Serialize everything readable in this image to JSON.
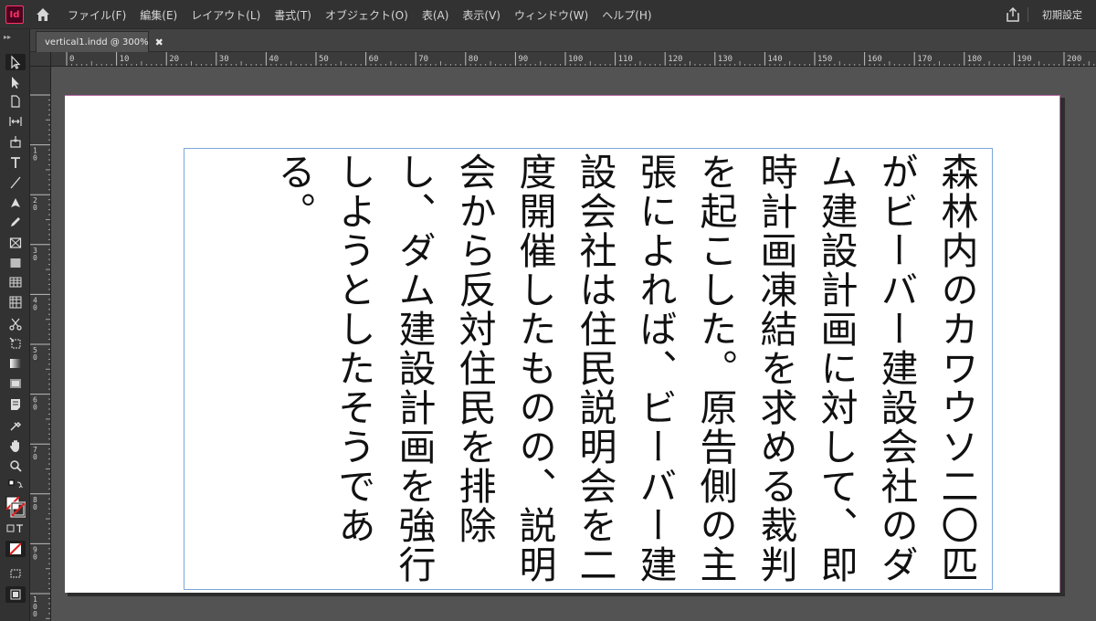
{
  "app": {
    "icon_label": "Id"
  },
  "menu": {
    "items": [
      "ファイル(F)",
      "編集(E)",
      "レイアウト(L)",
      "書式(T)",
      "オブジェクト(O)",
      "表(A)",
      "表示(V)",
      "ウィンドウ(W)",
      "ヘルプ(H)"
    ],
    "workspace": "初期設定"
  },
  "tab": {
    "label": "vertical1.indd @ 300%",
    "close": "✖"
  },
  "ruler": {
    "h_ticks": [
      "0",
      "10",
      "20",
      "30",
      "40",
      "50",
      "60",
      "70",
      "80",
      "90",
      "100",
      "110",
      "120",
      "130",
      "140",
      "150",
      "160",
      "170",
      "180",
      "190",
      "200"
    ],
    "v_ticks": [
      "1\n0",
      "2\n0",
      "3\n0",
      "4\n0",
      "5\n0",
      "6\n0",
      "7\n0",
      "8\n0",
      "9\n0",
      "1\n0\n0"
    ]
  },
  "document": {
    "text": "森林内のカワウソ二〇匹がビーバー建設会社のダム建設計画に対して、即時計画凍結を求める裁判を起こした。原告側の主張によれば、ビーバー建設会社は住民説明会を二度開催したものの、説明会から反対住民を排除し、ダム建設計画を強行しようとしたそうである。"
  },
  "tools": [
    "selection-tool-icon",
    "direct-selection-tool-icon",
    "page-tool-icon",
    "gap-tool-icon",
    "content-collector-icon",
    "type-tool-icon",
    "line-tool-icon",
    "pen-tool-icon",
    "pencil-tool-icon",
    "rectangle-frame-tool-icon",
    "rectangle-tool-icon",
    "table-icon",
    "grid-icon",
    "scissors-tool-icon",
    "free-transform-tool-icon",
    "gradient-swatch-tool-icon",
    "gradient-feather-tool-icon",
    "note-tool-icon",
    "eyedropper-tool-icon",
    "hand-tool-icon",
    "zoom-tool-icon"
  ]
}
